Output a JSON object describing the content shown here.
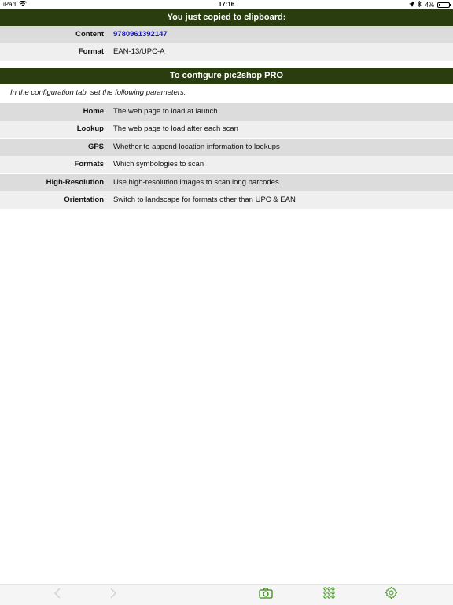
{
  "status": {
    "device": "iPad",
    "time": "17:16",
    "battery": "4%",
    "battery_level": 0.04
  },
  "clipboard": {
    "title": "You just copied to clipboard:",
    "rows": [
      {
        "label": "Content",
        "value": "9780961392147"
      },
      {
        "label": "Format",
        "value": "EAN-13/UPC-A"
      }
    ]
  },
  "config": {
    "title": "To configure pic2shop PRO",
    "intro": "In the configuration tab, set the following parameters:",
    "rows": [
      {
        "label": "Home",
        "value": "The web page to load at launch"
      },
      {
        "label": "Lookup",
        "value": "The web page to load after each scan"
      },
      {
        "label": "GPS",
        "value": "Whether to append location information to lookups"
      },
      {
        "label": "Formats",
        "value": "Which symbologies to scan"
      },
      {
        "label": "High-Resolution",
        "value": "Use high-resolution images to scan long barcodes"
      },
      {
        "label": "Orientation",
        "value": "Switch to landscape for formats other than UPC & EAN"
      }
    ]
  },
  "toolbar": {
    "back_icon": "chevron-left-icon",
    "forward_icon": "chevron-right-icon",
    "camera_icon": "camera-icon",
    "grid_icon": "grid-icon",
    "settings_icon": "gear-icon"
  },
  "colors": {
    "header_bg": "#2a3d0e",
    "accent": "#3a8a1a",
    "link": "#1a1ab3"
  }
}
